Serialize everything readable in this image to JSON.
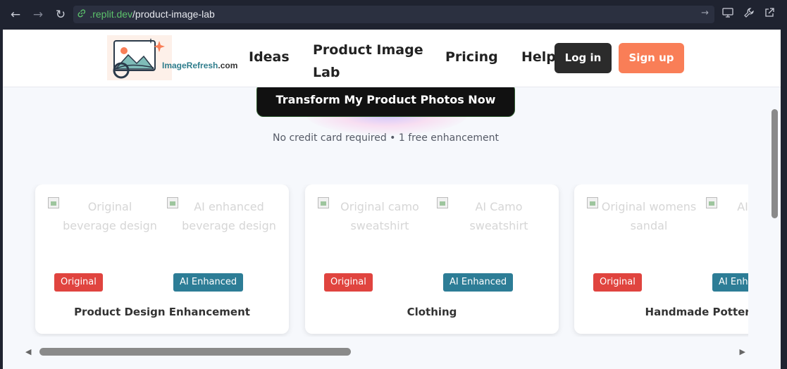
{
  "browser": {
    "back_icon": "←",
    "forward_icon": "→",
    "reload_icon": "↻",
    "url_host": ".replit.dev",
    "url_path": "/product-image-lab",
    "go_icon": "→",
    "link_icon": "🔗"
  },
  "header": {
    "logo_text": "ImageRefresh",
    "logo_domain": ".com",
    "nav": {
      "ideas": "Ideas",
      "lab": "Product Image Lab",
      "pricing": "Pricing",
      "help": "Help"
    },
    "login": "Log in",
    "signup": "Sign up"
  },
  "hero": {
    "cta": "Transform My Product Photos Now",
    "note": "No credit card required • 1 free enhancement"
  },
  "cards": [
    {
      "original_alt": "Original beverage design",
      "enhanced_alt": "AI enhanced beverage design",
      "badge_original": "Original",
      "badge_enhanced": "AI Enhanced",
      "title": "Product Design Enhancement"
    },
    {
      "original_alt": "Original camo sweatshirt",
      "enhanced_alt": "AI Camo sweatshirt",
      "badge_original": "Original",
      "badge_enhanced": "AI Enhanced",
      "title": "Clothing"
    },
    {
      "original_alt": "Original womens sandal",
      "enhanced_alt": "AI womens",
      "badge_original": "Original",
      "badge_enhanced": "AI Enhanced",
      "title": "Handmade Pottery"
    }
  ],
  "colors": {
    "signup": "#f97e57",
    "login": "#2b2b2b",
    "badge_original": "#e0443f",
    "badge_enhanced": "#2d7d96"
  }
}
